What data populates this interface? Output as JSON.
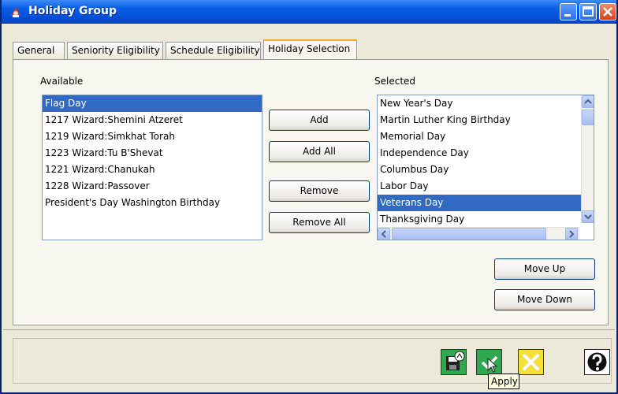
{
  "window": {
    "title": "Holiday Group"
  },
  "tabs": [
    {
      "label": "General"
    },
    {
      "label": "Seniority Eligibility"
    },
    {
      "label": "Schedule Eligibility"
    },
    {
      "label": "Holiday Selection",
      "active": true
    }
  ],
  "available": {
    "label": "Available",
    "items": [
      {
        "label": "Flag Day",
        "selected": true
      },
      {
        "label": "1217 Wizard:Shemini Atzeret"
      },
      {
        "label": "1219 Wizard:Simkhat Torah"
      },
      {
        "label": "1223 Wizard:Tu B'Shevat"
      },
      {
        "label": "1221 Wizard:Chanukah"
      },
      {
        "label": "1228 Wizard:Passover"
      },
      {
        "label": "President's Day Washington Birthday"
      }
    ]
  },
  "selected": {
    "label": "Selected",
    "items": [
      {
        "label": "New Year's Day"
      },
      {
        "label": "Martin Luther King Birthday"
      },
      {
        "label": "Memorial Day"
      },
      {
        "label": "Independence Day"
      },
      {
        "label": "Columbus Day"
      },
      {
        "label": "Labor Day"
      },
      {
        "label": "Veterans Day",
        "selected": true
      },
      {
        "label": "Thanksgiving Day"
      }
    ]
  },
  "buttons": {
    "add": "Add",
    "add_all": "Add All",
    "remove": "Remove",
    "remove_all": "Remove All",
    "move_up": "Move Up",
    "move_down": "Move Down"
  },
  "footer": {
    "tooltip": "Apply"
  },
  "colors": {
    "selection": "#316ac5",
    "titlebar": "#0554dd",
    "active_tab_accent": "#f2a62b"
  }
}
